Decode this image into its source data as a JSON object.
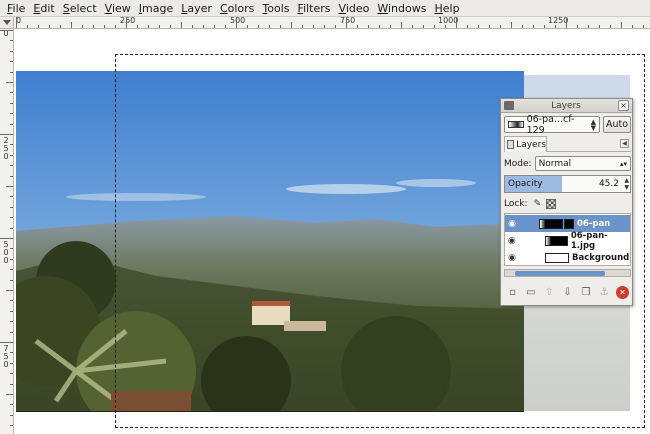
{
  "menubar": {
    "items": [
      "File",
      "Edit",
      "Select",
      "View",
      "Image",
      "Layer",
      "Colors",
      "Tools",
      "Filters",
      "Video",
      "Windows",
      "Help"
    ]
  },
  "rulers": {
    "horizontal_labels": [
      "0",
      "250",
      "500",
      "750",
      "1000",
      "1250"
    ],
    "vertical_labels": [
      "0",
      "250",
      "500",
      "750"
    ]
  },
  "layers_dialog": {
    "title": "Layers",
    "image_name": "06-pa...cf-129",
    "auto_label": "Auto",
    "tab_label": "Layers",
    "mode_label": "Mode:",
    "mode_value": "Normal",
    "opacity_label": "Opacity",
    "opacity_value": "45.2",
    "opacity_fraction": 0.452,
    "lock_label": "Lock:",
    "layers": [
      {
        "name": "06-pan",
        "selected": true,
        "thumb": "dark"
      },
      {
        "name": "06-pan-1.jpg",
        "selected": false,
        "thumb": "dark"
      },
      {
        "name": "Background",
        "selected": false,
        "thumb": "white"
      }
    ],
    "buttons": [
      "new-layer-icon",
      "new-group-icon",
      "raise-layer-icon",
      "lower-layer-icon",
      "duplicate-layer-icon",
      "anchor-layer-icon",
      "delete-layer-icon"
    ]
  },
  "colors": {
    "selection_highlight": "#6a93c9",
    "menubar_bg": "#eceae6"
  }
}
